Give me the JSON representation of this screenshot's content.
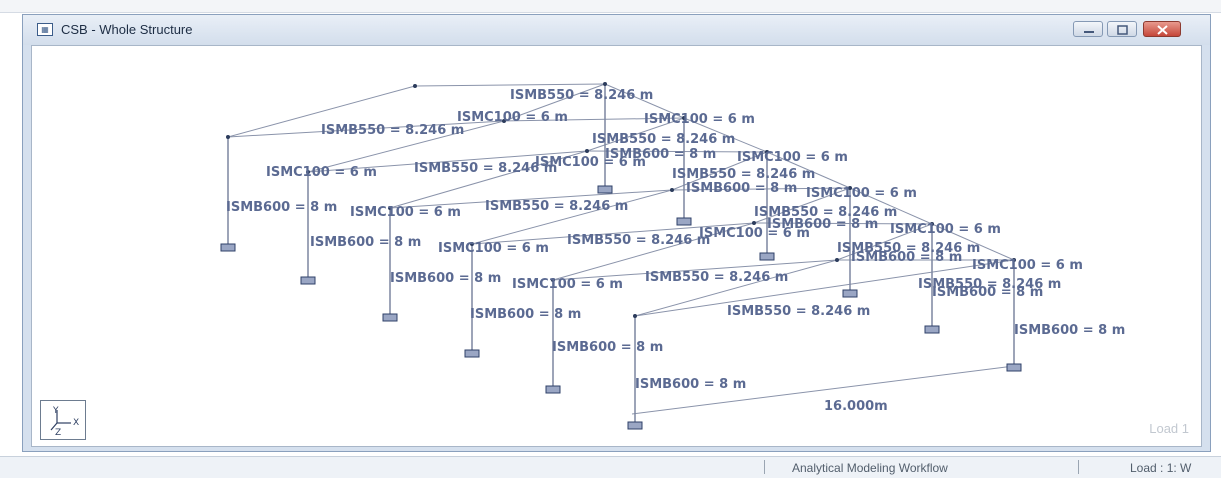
{
  "window": {
    "title": "CSB - Whole Structure",
    "icon": "structure-view-icon",
    "buttons": [
      "minimize-icon",
      "restore-icon",
      "close-icon"
    ]
  },
  "viewport": {
    "load_label": "Load 1",
    "dimension_label": "16.000m",
    "axis_icon": "axis-triad-icon",
    "member_labels": [
      "ISMB550 = 8.246 m",
      "ISMC100 = 6 m",
      "ISMB550 = 8.246 m",
      "ISMC100 = 6 m",
      "ISMB550 = 8.246 m",
      "ISMB600 = 8 m",
      "ISMC100 = 6 m",
      "ISMC100 = 6 m",
      "ISMB550 = 8.246 m",
      "ISMB550 = 8.246 m",
      "ISMC100 = 6 m",
      "ISMB600 = 8 m",
      "ISMC100 = 6 m",
      "ISMB550 = 8.246 m",
      "ISMB600 = 8 m",
      "ISMC100 = 6 m",
      "ISMB550 = 8.246 m",
      "ISMB600 = 8 m",
      "ISMC100 = 6 m",
      "ISMB600 = 8 m",
      "ISMC100 = 6 m",
      "ISMB550 = 8.246 m",
      "ISMB550 = 8.246 m",
      "ISMC100 = 6 m",
      "ISMB600 = 8 m",
      "ISMC100 = 6 m",
      "ISMB600 = 8 m",
      "ISMB550 = 8.246 m",
      "ISMB600 = 8 m",
      "ISMC100 = 6 m",
      "ISMB550 = 8.246 m",
      "ISMB550 = 8.246 m",
      "ISMB600 = 8 m",
      "ISMB600 = 8 m",
      "ISMB600 = 8 m",
      "ISMB600 = 8 m"
    ]
  },
  "statusbar": {
    "workflow": "Analytical Modeling Workflow",
    "load": "Load : 1: W"
  }
}
